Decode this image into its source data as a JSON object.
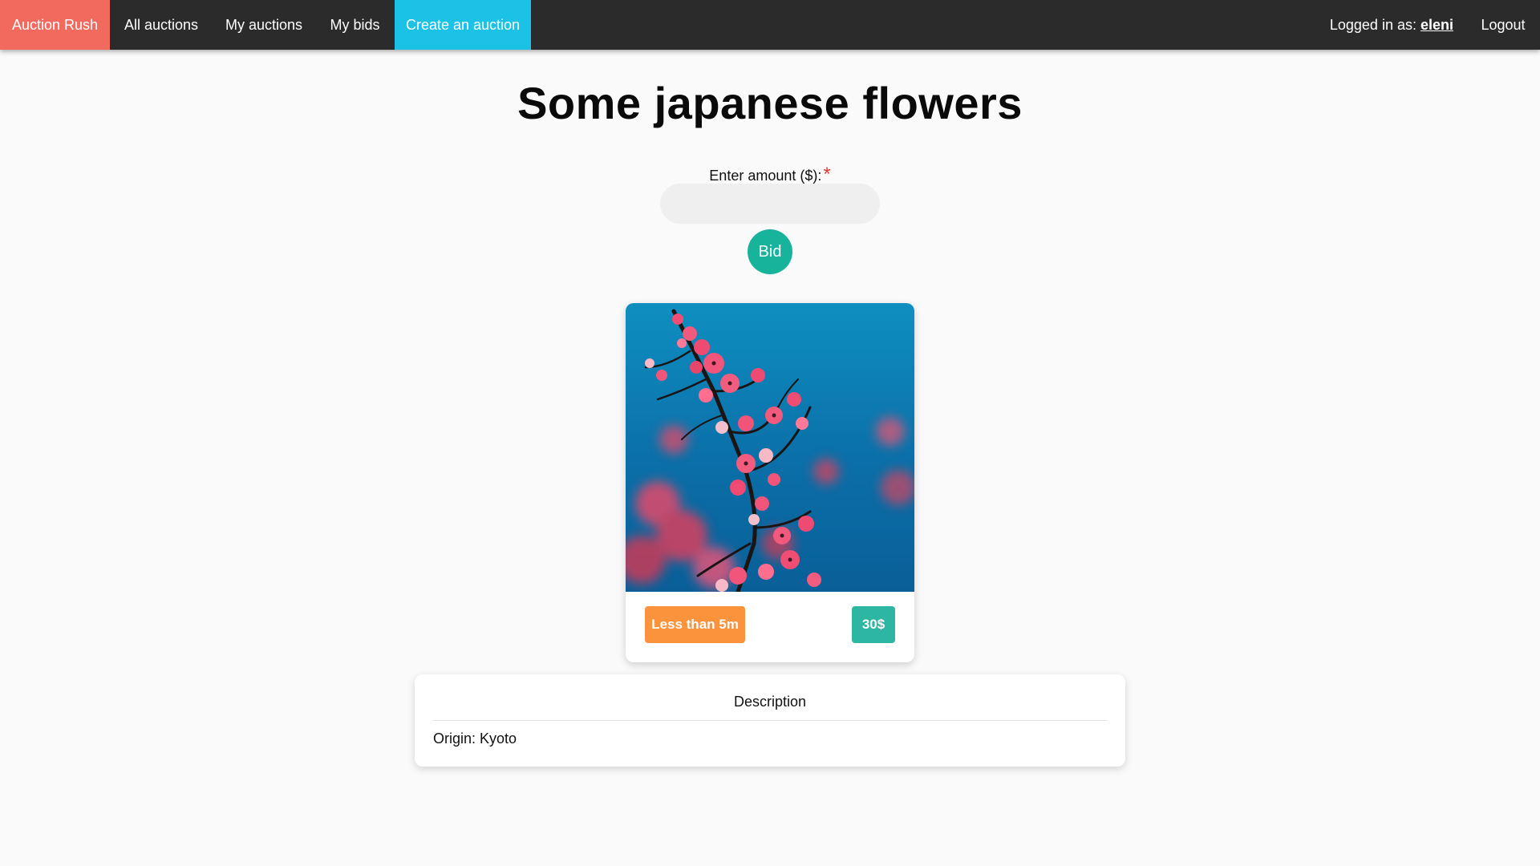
{
  "nav": {
    "brand": "Auction Rush",
    "all_auctions": "All auctions",
    "my_auctions": "My auctions",
    "my_bids": "My bids",
    "create_auction": "Create an auction",
    "logged_in_prefix": "Logged in as: ",
    "username": "eleni",
    "logout": "Logout"
  },
  "auction": {
    "title": "Some japanese flowers",
    "amount_label": "Enter amount ($):",
    "required_marker": "*",
    "amount_value": "",
    "bid_button": "Bid",
    "time_badge": "Less than 5m",
    "price_badge": "30$",
    "image_alt": "cherry-blossom-branch"
  },
  "description": {
    "heading": "Description",
    "text": "Origin: Kyoto"
  },
  "colors": {
    "navbar": "#2b2b2b",
    "brand": "#f26a5e",
    "create": "#1cc2e6",
    "bid_button": "#17b39a",
    "time_badge": "#fb923c",
    "price_badge": "#2db7a3"
  }
}
